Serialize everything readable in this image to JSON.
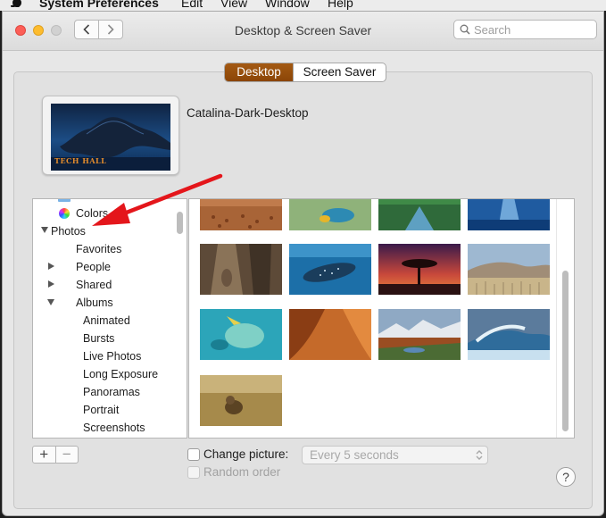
{
  "menubar": {
    "app_name": "System Preferences",
    "items": [
      "Edit",
      "View",
      "Window",
      "Help"
    ]
  },
  "window": {
    "title": "Desktop & Screen Saver",
    "search_placeholder": "Search"
  },
  "tabs": [
    {
      "label": "Desktop",
      "active": true
    },
    {
      "label": "Screen Saver",
      "active": false
    }
  ],
  "current_wallpaper": {
    "name": "Catalina-Dark-Desktop",
    "watermark": "TECH HALL"
  },
  "sidebar": {
    "items": [
      {
        "label": "Colors",
        "disclosure": "none"
      },
      {
        "label": "Photos",
        "disclosure": "expanded"
      },
      {
        "label": "Favorites",
        "disclosure": "none"
      },
      {
        "label": "People",
        "disclosure": "collapsed"
      },
      {
        "label": "Shared",
        "disclosure": "collapsed"
      },
      {
        "label": "Albums",
        "disclosure": "expanded"
      },
      {
        "label": "Animated",
        "disclosure": "none"
      },
      {
        "label": "Bursts",
        "disclosure": "none"
      },
      {
        "label": "Live Photos",
        "disclosure": "none"
      },
      {
        "label": "Long Exposure",
        "disclosure": "none"
      },
      {
        "label": "Panoramas",
        "disclosure": "none"
      },
      {
        "label": "Portrait",
        "disclosure": "none"
      },
      {
        "label": "Screenshots",
        "disclosure": "none"
      }
    ]
  },
  "controls": {
    "add_label": "+",
    "remove_label": "−",
    "change_picture_label": "Change picture:",
    "change_picture_checked": false,
    "interval_value": "Every 5 seconds",
    "random_order_label": "Random order",
    "random_order_enabled": false,
    "help_label": "?"
  },
  "colors": {
    "accent": "#97500d",
    "annotation_arrow": "#e4161b"
  }
}
